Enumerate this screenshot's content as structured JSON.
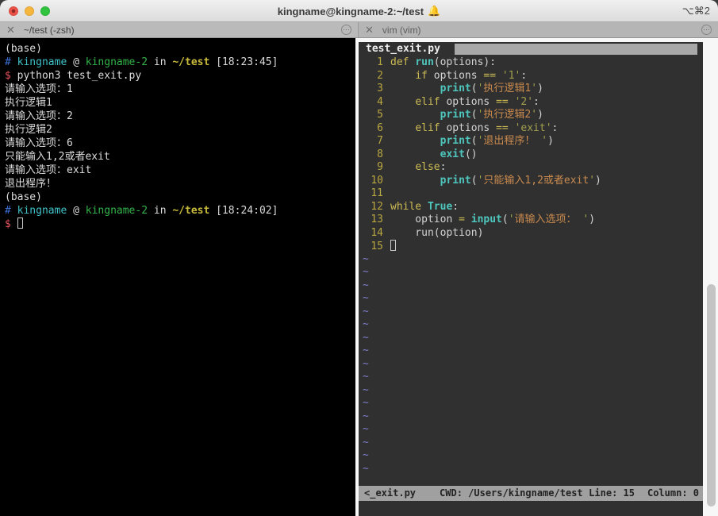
{
  "window": {
    "title": "kingname@kingname-2:~/test",
    "bell": "🔔",
    "shortcut": "⌥⌘2"
  },
  "tabs": [
    {
      "close": "✕",
      "label": "~/test (-zsh)",
      "menu": "⋯"
    },
    {
      "close": "✕",
      "label": "vim (vim)",
      "menu": "⋯"
    }
  ],
  "terminal": {
    "lines": [
      {
        "segments": [
          {
            "t": "(base)",
            "c": "d"
          }
        ]
      },
      {
        "segments": [
          {
            "t": "# ",
            "c": "b"
          },
          {
            "t": "kingname",
            "c": "c"
          },
          {
            "t": " @ ",
            "c": "d"
          },
          {
            "t": "kingname-2",
            "c": "g"
          },
          {
            "t": " in ",
            "c": "d"
          },
          {
            "t": "~/test",
            "c": "y"
          },
          {
            "t": " [18:23:45]",
            "c": "d"
          }
        ]
      },
      {
        "segments": [
          {
            "t": "$ ",
            "c": "r"
          },
          {
            "t": "python3 test_exit.py",
            "c": "d"
          }
        ]
      },
      {
        "segments": [
          {
            "t": "请输入选项：1",
            "c": "d"
          }
        ]
      },
      {
        "segments": [
          {
            "t": "执行逻辑1",
            "c": "d"
          }
        ]
      },
      {
        "segments": [
          {
            "t": "请输入选项：2",
            "c": "d"
          }
        ]
      },
      {
        "segments": [
          {
            "t": "执行逻辑2",
            "c": "d"
          }
        ]
      },
      {
        "segments": [
          {
            "t": "请输入选项：6",
            "c": "d"
          }
        ]
      },
      {
        "segments": [
          {
            "t": "只能输入1,2或者exit",
            "c": "d"
          }
        ]
      },
      {
        "segments": [
          {
            "t": "请输入选项：exit",
            "c": "d"
          }
        ]
      },
      {
        "segments": [
          {
            "t": "退出程序！",
            "c": "d"
          }
        ]
      },
      {
        "segments": [
          {
            "t": "(base)",
            "c": "d"
          }
        ]
      },
      {
        "segments": [
          {
            "t": "# ",
            "c": "b"
          },
          {
            "t": "kingname",
            "c": "c"
          },
          {
            "t": " @ ",
            "c": "d"
          },
          {
            "t": "kingname-2",
            "c": "g"
          },
          {
            "t": " in ",
            "c": "d"
          },
          {
            "t": "~/test",
            "c": "y"
          },
          {
            "t": " [18:24:02]",
            "c": "d"
          }
        ]
      },
      {
        "segments": [
          {
            "t": "$ ",
            "c": "r"
          }
        ],
        "cursor": true
      }
    ]
  },
  "vim": {
    "buffer_label": "test_exit.py ",
    "code_lines": [
      {
        "num": "1",
        "segments": [
          {
            "t": "def ",
            "c": "k"
          },
          {
            "t": "run",
            "c": "f"
          },
          {
            "t": "(options):",
            "c": "t"
          }
        ]
      },
      {
        "num": "2",
        "segments": [
          {
            "t": "    ",
            "c": "t"
          },
          {
            "t": "if",
            "c": "k"
          },
          {
            "t": " options ",
            "c": "t"
          },
          {
            "t": "==",
            "c": "k"
          },
          {
            "t": " ",
            "c": "t"
          },
          {
            "t": "'1'",
            "c": "s"
          },
          {
            "t": ":",
            "c": "t"
          }
        ]
      },
      {
        "num": "3",
        "segments": [
          {
            "t": "        ",
            "c": "t"
          },
          {
            "t": "print",
            "c": "f"
          },
          {
            "t": "(",
            "c": "t"
          },
          {
            "t": "'",
            "c": "s"
          },
          {
            "t": "执行逻辑1",
            "c": "z"
          },
          {
            "t": "'",
            "c": "s"
          },
          {
            "t": ")",
            "c": "t"
          }
        ]
      },
      {
        "num": "4",
        "segments": [
          {
            "t": "    ",
            "c": "t"
          },
          {
            "t": "elif",
            "c": "k"
          },
          {
            "t": " options ",
            "c": "t"
          },
          {
            "t": "==",
            "c": "k"
          },
          {
            "t": " ",
            "c": "t"
          },
          {
            "t": "'2'",
            "c": "s"
          },
          {
            "t": ":",
            "c": "t"
          }
        ]
      },
      {
        "num": "5",
        "segments": [
          {
            "t": "        ",
            "c": "t"
          },
          {
            "t": "print",
            "c": "f"
          },
          {
            "t": "(",
            "c": "t"
          },
          {
            "t": "'",
            "c": "s"
          },
          {
            "t": "执行逻辑2",
            "c": "z"
          },
          {
            "t": "'",
            "c": "s"
          },
          {
            "t": ")",
            "c": "t"
          }
        ]
      },
      {
        "num": "6",
        "segments": [
          {
            "t": "    ",
            "c": "t"
          },
          {
            "t": "elif",
            "c": "k"
          },
          {
            "t": " options ",
            "c": "t"
          },
          {
            "t": "==",
            "c": "k"
          },
          {
            "t": " ",
            "c": "t"
          },
          {
            "t": "'exit'",
            "c": "s"
          },
          {
            "t": ":",
            "c": "t"
          }
        ]
      },
      {
        "num": "7",
        "segments": [
          {
            "t": "        ",
            "c": "t"
          },
          {
            "t": "print",
            "c": "f"
          },
          {
            "t": "(",
            "c": "t"
          },
          {
            "t": "'",
            "c": "s"
          },
          {
            "t": "退出程序！ ",
            "c": "z"
          },
          {
            "t": "'",
            "c": "s"
          },
          {
            "t": ")",
            "c": "t"
          }
        ]
      },
      {
        "num": "8",
        "segments": [
          {
            "t": "        ",
            "c": "t"
          },
          {
            "t": "exit",
            "c": "f"
          },
          {
            "t": "()",
            "c": "t"
          }
        ]
      },
      {
        "num": "9",
        "segments": [
          {
            "t": "    ",
            "c": "t"
          },
          {
            "t": "else",
            "c": "k"
          },
          {
            "t": ":",
            "c": "t"
          }
        ]
      },
      {
        "num": "10",
        "segments": [
          {
            "t": "        ",
            "c": "t"
          },
          {
            "t": "print",
            "c": "f"
          },
          {
            "t": "(",
            "c": "t"
          },
          {
            "t": "'",
            "c": "s"
          },
          {
            "t": "只能输入1,2或者exit",
            "c": "z"
          },
          {
            "t": "'",
            "c": "s"
          },
          {
            "t": ")",
            "c": "t"
          }
        ]
      },
      {
        "num": "11",
        "segments": []
      },
      {
        "num": "12",
        "segments": [
          {
            "t": "while",
            "c": "k"
          },
          {
            "t": " ",
            "c": "t"
          },
          {
            "t": "True",
            "c": "f"
          },
          {
            "t": ":",
            "c": "t"
          }
        ]
      },
      {
        "num": "13",
        "segments": [
          {
            "t": "    option ",
            "c": "t"
          },
          {
            "t": "=",
            "c": "k"
          },
          {
            "t": " ",
            "c": "t"
          },
          {
            "t": "input",
            "c": "f"
          },
          {
            "t": "(",
            "c": "t"
          },
          {
            "t": "'",
            "c": "s"
          },
          {
            "t": "请输入选项： ",
            "c": "z"
          },
          {
            "t": "'",
            "c": "s"
          },
          {
            "t": ")",
            "c": "t"
          }
        ]
      },
      {
        "num": "14",
        "segments": [
          {
            "t": "    run(option)",
            "c": "t"
          }
        ]
      },
      {
        "num": "15",
        "segments": [],
        "cursor": true
      }
    ],
    "tilde": "~",
    "tilde_count": 17,
    "status": {
      "file": "<_exit.py",
      "cwd": "CWD: /Users/kingname/test",
      "line": "Line: 15",
      "column": "Column: 0"
    }
  },
  "colors": {
    "terminal_bg": "#000000",
    "vim_bg": "#303030",
    "prompt_blue": "#3a70d8",
    "prompt_cyan": "#3fc2c9",
    "prompt_green": "#33b44a",
    "prompt_yellow": "#c9bb3c",
    "prompt_red": "#e8555e",
    "keyword_yellow": "#cdbb54",
    "builtin_cyan": "#4fc6bd",
    "string_olive": "#a2a04e",
    "string_cjk_orange": "#c98a4e",
    "tilde_purple": "#7e7ed0",
    "statusbar_grey": "#a0a0a0"
  }
}
